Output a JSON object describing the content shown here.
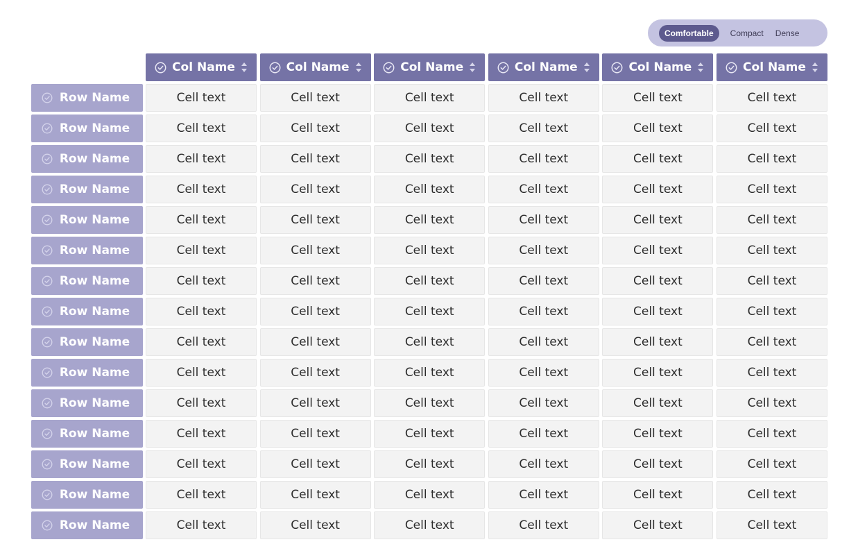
{
  "density_toggle": {
    "options": [
      "Comfortable",
      "Compact",
      "Dense"
    ],
    "selected": "Comfortable"
  },
  "table": {
    "columns": [
      "Col Name",
      "Col Name",
      "Col Name",
      "Col Name",
      "Col Name",
      "Col Name"
    ],
    "rows": [
      {
        "name": "Row Name",
        "cells": [
          "Cell text",
          "Cell text",
          "Cell text",
          "Cell text",
          "Cell text",
          "Cell text"
        ]
      },
      {
        "name": "Row Name",
        "cells": [
          "Cell text",
          "Cell text",
          "Cell text",
          "Cell text",
          "Cell text",
          "Cell text"
        ]
      },
      {
        "name": "Row Name",
        "cells": [
          "Cell text",
          "Cell text",
          "Cell text",
          "Cell text",
          "Cell text",
          "Cell text"
        ]
      },
      {
        "name": "Row Name",
        "cells": [
          "Cell text",
          "Cell text",
          "Cell text",
          "Cell text",
          "Cell text",
          "Cell text"
        ]
      },
      {
        "name": "Row Name",
        "cells": [
          "Cell text",
          "Cell text",
          "Cell text",
          "Cell text",
          "Cell text",
          "Cell text"
        ]
      },
      {
        "name": "Row Name",
        "cells": [
          "Cell text",
          "Cell text",
          "Cell text",
          "Cell text",
          "Cell text",
          "Cell text"
        ]
      },
      {
        "name": "Row Name",
        "cells": [
          "Cell text",
          "Cell text",
          "Cell text",
          "Cell text",
          "Cell text",
          "Cell text"
        ]
      },
      {
        "name": "Row Name",
        "cells": [
          "Cell text",
          "Cell text",
          "Cell text",
          "Cell text",
          "Cell text",
          "Cell text"
        ]
      },
      {
        "name": "Row Name",
        "cells": [
          "Cell text",
          "Cell text",
          "Cell text",
          "Cell text",
          "Cell text",
          "Cell text"
        ]
      },
      {
        "name": "Row Name",
        "cells": [
          "Cell text",
          "Cell text",
          "Cell text",
          "Cell text",
          "Cell text",
          "Cell text"
        ]
      },
      {
        "name": "Row Name",
        "cells": [
          "Cell text",
          "Cell text",
          "Cell text",
          "Cell text",
          "Cell text",
          "Cell text"
        ]
      },
      {
        "name": "Row Name",
        "cells": [
          "Cell text",
          "Cell text",
          "Cell text",
          "Cell text",
          "Cell text",
          "Cell text"
        ]
      },
      {
        "name": "Row Name",
        "cells": [
          "Cell text",
          "Cell text",
          "Cell text",
          "Cell text",
          "Cell text",
          "Cell text"
        ]
      },
      {
        "name": "Row Name",
        "cells": [
          "Cell text",
          "Cell text",
          "Cell text",
          "Cell text",
          "Cell text",
          "Cell text"
        ]
      },
      {
        "name": "Row Name",
        "cells": [
          "Cell text",
          "Cell text",
          "Cell text",
          "Cell text",
          "Cell text",
          "Cell text"
        ]
      }
    ]
  },
  "icons": {
    "column_header_icons": [
      "check-circle-icon",
      "sort-icon"
    ],
    "row_header_icon": "check-circle-icon"
  },
  "colors": {
    "column_header_bg": "#7573a6",
    "row_header_bg": "#a7a5cd",
    "cell_bg": "#f3f3f3",
    "toggle_bg": "#c4c3e1",
    "toggle_active_bg": "#5d5a8e"
  }
}
